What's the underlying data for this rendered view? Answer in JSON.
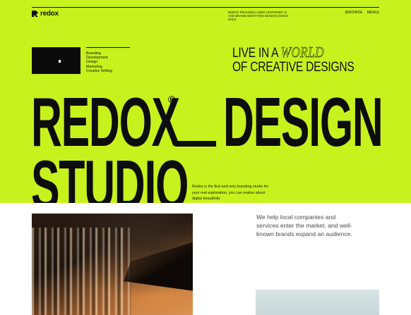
{
  "brand": {
    "name": "redox"
  },
  "nav": {
    "tagline": "REDOX PROVIDES USER CENTERED UI AND BRAND IDENTITIES DESIGN (SINCE 2012)",
    "links": [
      "(BROWSE",
      "MENU)"
    ]
  },
  "services": [
    "Branding",
    "Development",
    "Design",
    "Marketing",
    "Creative Writing"
  ],
  "headline": {
    "line1_a": "LIVE IN A",
    "line1_b": "WORLD",
    "line2": "OF CREATIVE DESIGNS"
  },
  "hero": {
    "word1": "REDOX",
    "registered": "®",
    "word2": "DESIGN",
    "word3": "STUDIO"
  },
  "blurb": "Redox is the first and only branding studio for your real exploration, you can realize about digital beautifully",
  "lower": {
    "text": "We help local companies and services enter the market, and well-known brands expand an audience."
  },
  "colors": {
    "accent": "#c8f21d",
    "text": "#111111"
  }
}
